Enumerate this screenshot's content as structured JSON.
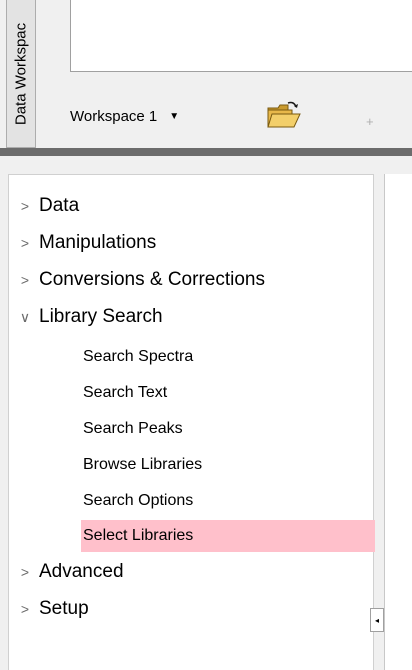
{
  "workspace_panel": {
    "vertical_tab": "Data Workspac",
    "dropdown_label": "Workspace 1",
    "dropdown_caret": "▼"
  },
  "icons": {
    "open_workspace": "open-folder-icon",
    "toolbar_separator": "+"
  },
  "tree": {
    "collapsed_chevron": ">",
    "expanded_chevron": "∨",
    "items": [
      {
        "label": "Data",
        "expanded": false
      },
      {
        "label": "Manipulations",
        "expanded": false
      },
      {
        "label": "Conversions & Corrections",
        "expanded": false
      },
      {
        "label": "Library Search",
        "expanded": true,
        "children": [
          {
            "label": "Search Spectra",
            "selected": false
          },
          {
            "label": "Search Text",
            "selected": false
          },
          {
            "label": "Search Peaks",
            "selected": false
          },
          {
            "label": "Browse Libraries",
            "selected": false
          },
          {
            "label": "Search Options",
            "selected": false
          },
          {
            "label": "Select Libraries",
            "selected": true
          }
        ]
      },
      {
        "label": "Advanced",
        "expanded": false
      },
      {
        "label": "Setup",
        "expanded": false
      }
    ]
  },
  "scroll_left_glyph": "◂",
  "colors": {
    "selection": "#ffc0cb",
    "divider": "#6c6c6c",
    "folder": "#e8b84a"
  }
}
